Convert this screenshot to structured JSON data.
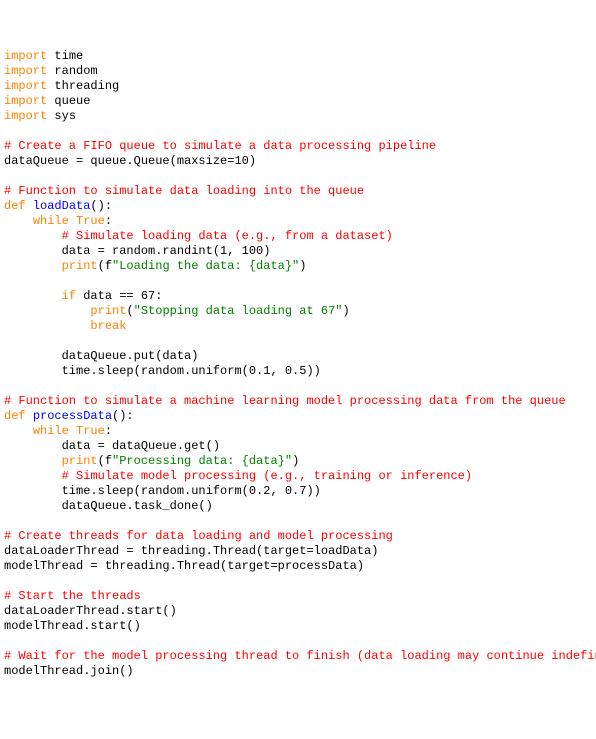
{
  "tokens": [
    {
      "cls": "orange",
      "t": "import"
    },
    {
      "t": " time\n"
    },
    {
      "cls": "orange",
      "t": "import"
    },
    {
      "t": " random\n"
    },
    {
      "cls": "orange",
      "t": "import"
    },
    {
      "t": " threading\n"
    },
    {
      "cls": "orange",
      "t": "import"
    },
    {
      "t": " queue\n"
    },
    {
      "cls": "orange",
      "t": "import"
    },
    {
      "t": " sys\n"
    },
    {
      "t": "\n"
    },
    {
      "cls": "red",
      "t": "# Create a FIFO queue to simulate a data processing pipeline"
    },
    {
      "t": "\n"
    },
    {
      "t": "dataQueue = queue.Queue(maxsize=10)\n"
    },
    {
      "t": "\n"
    },
    {
      "cls": "red",
      "t": "# Function to simulate data loading into the queue"
    },
    {
      "t": "\n"
    },
    {
      "cls": "orange",
      "t": "def"
    },
    {
      "t": " "
    },
    {
      "cls": "blue",
      "t": "loadData"
    },
    {
      "t": "():\n"
    },
    {
      "t": "    "
    },
    {
      "cls": "orange",
      "t": "while"
    },
    {
      "t": " "
    },
    {
      "cls": "orange",
      "t": "True"
    },
    {
      "t": ":\n"
    },
    {
      "t": "        "
    },
    {
      "cls": "red",
      "t": "# Simulate loading data (e.g., from a dataset)"
    },
    {
      "t": "\n"
    },
    {
      "t": "        data = random.randint(1, 100)\n"
    },
    {
      "t": "        "
    },
    {
      "cls": "orange",
      "t": "print"
    },
    {
      "t": "(f"
    },
    {
      "cls": "green",
      "t": "\"Loading the data: {data}\""
    },
    {
      "t": ")\n"
    },
    {
      "t": "\n"
    },
    {
      "t": "        "
    },
    {
      "cls": "orange",
      "t": "if"
    },
    {
      "t": " data == 67:\n"
    },
    {
      "t": "            "
    },
    {
      "cls": "orange",
      "t": "print"
    },
    {
      "t": "("
    },
    {
      "cls": "green",
      "t": "\"Stopping data loading at 67\""
    },
    {
      "t": ")\n"
    },
    {
      "t": "            "
    },
    {
      "cls": "orange",
      "t": "break"
    },
    {
      "t": "\n"
    },
    {
      "t": "\n"
    },
    {
      "t": "        dataQueue.put(data)\n"
    },
    {
      "t": "        time.sleep(random.uniform(0.1, 0.5))\n"
    },
    {
      "t": "\n"
    },
    {
      "cls": "red",
      "t": "# Function to simulate a machine learning model processing data from the queue"
    },
    {
      "t": "\n"
    },
    {
      "cls": "orange",
      "t": "def"
    },
    {
      "t": " "
    },
    {
      "cls": "blue",
      "t": "processData"
    },
    {
      "t": "():\n"
    },
    {
      "t": "    "
    },
    {
      "cls": "orange",
      "t": "while"
    },
    {
      "t": " "
    },
    {
      "cls": "orange",
      "t": "True"
    },
    {
      "t": ":\n"
    },
    {
      "t": "        data = dataQueue.get()\n"
    },
    {
      "t": "        "
    },
    {
      "cls": "orange",
      "t": "print"
    },
    {
      "t": "(f"
    },
    {
      "cls": "green",
      "t": "\"Processing data: {data}\""
    },
    {
      "t": ")\n"
    },
    {
      "t": "        "
    },
    {
      "cls": "red",
      "t": "# Simulate model processing (e.g., training or inference)"
    },
    {
      "t": "\n"
    },
    {
      "t": "        time.sleep(random.uniform(0.2, 0.7))\n"
    },
    {
      "t": "        dataQueue.task_done()\n"
    },
    {
      "t": "\n"
    },
    {
      "cls": "red",
      "t": "# Create threads for data loading and model processing"
    },
    {
      "t": "\n"
    },
    {
      "t": "dataLoaderThread = threading.Thread(target=loadData)\n"
    },
    {
      "t": "modelThread = threading.Thread(target=processData)\n"
    },
    {
      "t": "\n"
    },
    {
      "cls": "red",
      "t": "# Start the threads"
    },
    {
      "t": "\n"
    },
    {
      "t": "dataLoaderThread.start()\n"
    },
    {
      "t": "modelThread.start()\n"
    },
    {
      "t": "\n"
    },
    {
      "cls": "red",
      "t": "# Wait for the model processing thread to finish (data loading may continue indefinitely)"
    },
    {
      "t": "\n"
    },
    {
      "t": "modelThread.join()\n"
    }
  ]
}
